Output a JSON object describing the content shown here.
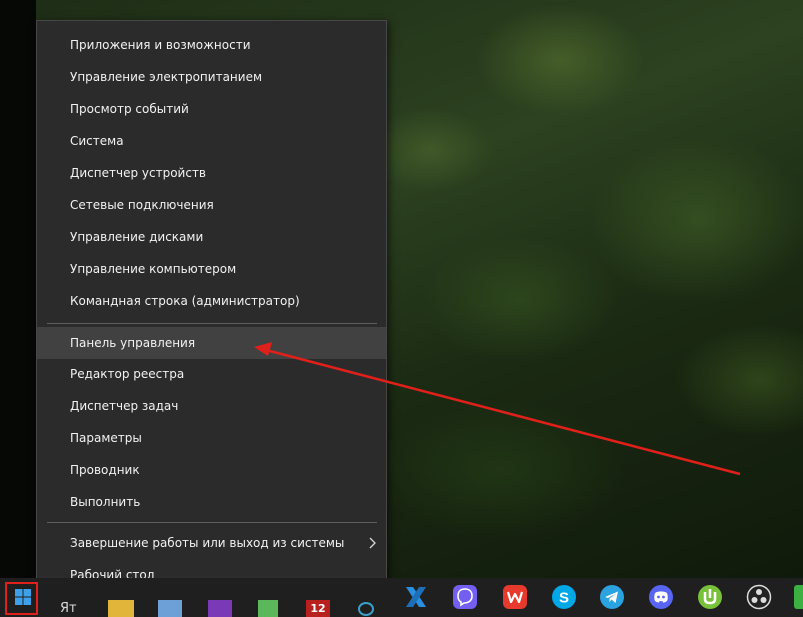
{
  "menu": {
    "items_group1": [
      {
        "label": "Приложения и возможности"
      },
      {
        "label": "Управление электропитанием"
      },
      {
        "label": "Просмотр событий"
      },
      {
        "label": "Система"
      },
      {
        "label": "Диспетчер устройств"
      },
      {
        "label": "Сетевые подключения"
      },
      {
        "label": "Управление дисками"
      },
      {
        "label": "Управление компьютером"
      },
      {
        "label": "Командная строка (администратор)"
      }
    ],
    "items_group2": [
      {
        "label": "Панель управления",
        "highlighted": true
      },
      {
        "label": "Редактор реестра"
      },
      {
        "label": "Диспетчер задач"
      },
      {
        "label": "Параметры"
      },
      {
        "label": "Проводник"
      },
      {
        "label": "Выполнить"
      }
    ],
    "items_group3": [
      {
        "label": "Завершение работы или выход из системы",
        "has_submenu": true
      },
      {
        "label": "Рабочий стол"
      }
    ]
  },
  "taskbar": {
    "start_icon": "windows-logo-icon",
    "partial_text": "Ят",
    "partial_number": "12",
    "apps": [
      {
        "icon": "x-app-icon"
      },
      {
        "icon": "viber-icon"
      },
      {
        "icon": "wps-office-icon"
      },
      {
        "icon": "skype-icon",
        "letter": "S"
      },
      {
        "icon": "telegram-icon"
      },
      {
        "icon": "discord-icon"
      },
      {
        "icon": "utorrent-icon"
      },
      {
        "icon": "obs-icon"
      },
      {
        "icon": "green-app-icon"
      }
    ]
  },
  "annotation": {
    "arrow_color": "#e0201a",
    "highlight_color": "#e0201a"
  }
}
